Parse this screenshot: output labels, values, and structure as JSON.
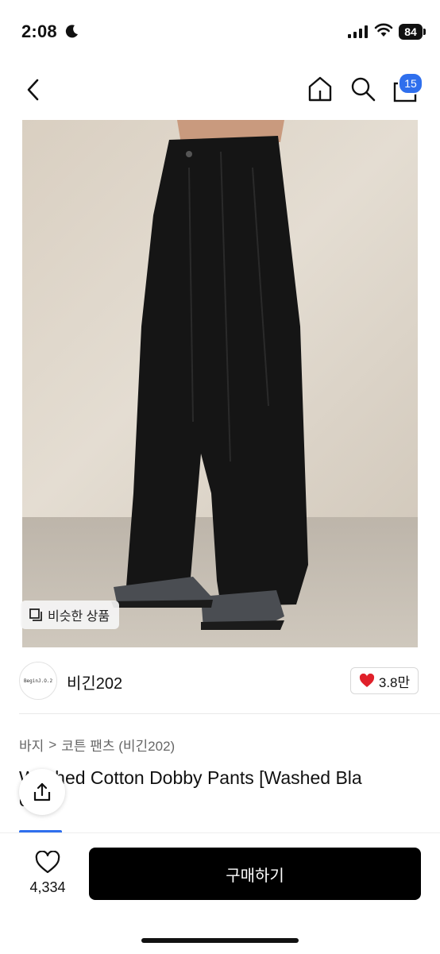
{
  "status_bar": {
    "time": "2:08",
    "battery": "84"
  },
  "nav": {
    "cart_count": "15"
  },
  "product": {
    "similar_label": "비슷한 상품",
    "brand_logo_text": "BeginJ.O.2",
    "brand_name": "비긴202",
    "brand_likes": "3.8만",
    "breadcrumb": [
      "바지",
      ">",
      "코튼 팬츠 (비긴202)"
    ],
    "title_line1": "Washed Cotton Dobby Pants [Washed Bla",
    "title_line2": "ck]"
  },
  "bottom_bar": {
    "wish_count": "4,334",
    "buy_label": "구매하기"
  },
  "colors": {
    "accent": "#2f6fed",
    "heart": "#e0202a",
    "buy_button": "#000000"
  }
}
